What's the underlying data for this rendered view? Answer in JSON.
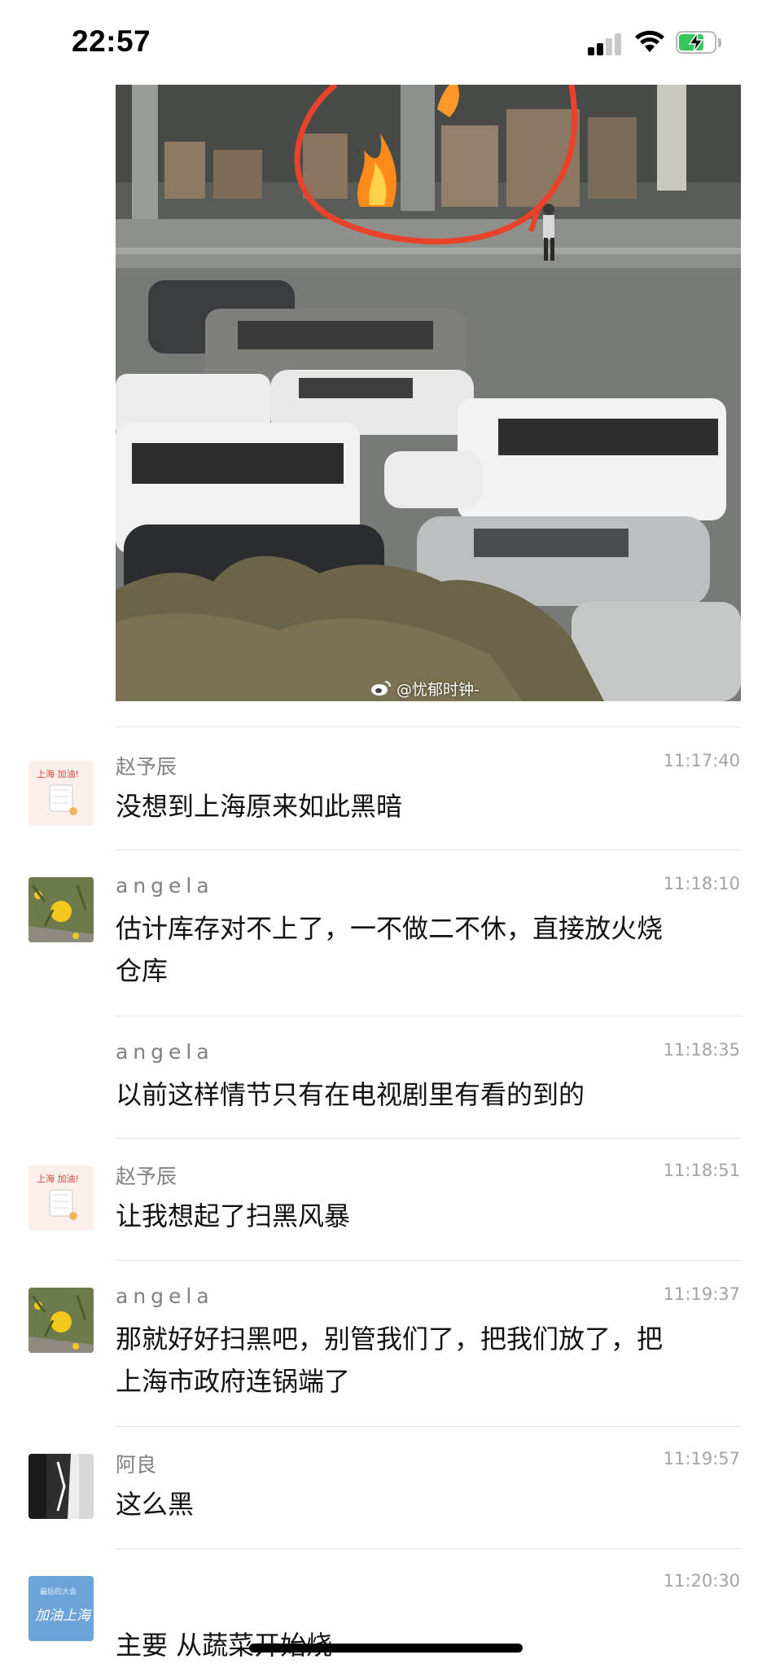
{
  "status_bar": {
    "time": "22:57"
  },
  "shared_image": {
    "description_icon": "weibo-icon",
    "watermark": "@忧郁时钟-"
  },
  "messages": [
    {
      "sender": "赵予辰",
      "time": "11:17:40",
      "text": "没想到上海原来如此黑暗",
      "avatar": "avatar-zhao",
      "avatar_text": "上海 加油!"
    },
    {
      "sender": "angela",
      "time": "11:18:10",
      "text_lines": [
        "估计库存对不上了，一不做二不休，直接放火烧",
        "仓库"
      ],
      "avatar": "avatar-angela"
    },
    {
      "sender": "angela",
      "time": "11:18:35",
      "text": "以前这样情节只有在电视剧里有看的到的"
    },
    {
      "sender": "赵予辰",
      "time": "11:18:51",
      "text": "让我想起了扫黑风暴",
      "avatar": "avatar-zhao",
      "avatar_text": "上海 加油!"
    },
    {
      "sender": "angela",
      "time": "11:19:37",
      "text_lines": [
        "那就好好扫黑吧，别管我们了，把我们放了，把",
        "上海市政府连锅端了"
      ],
      "avatar": "avatar-angela"
    },
    {
      "sender": "阿良",
      "time": "11:19:57",
      "text": "这么黑",
      "avatar": "avatar-aliang"
    },
    {
      "sender": "",
      "time": "11:20:30",
      "text": "主要 从蔬菜开始烧",
      "avatar": "avatar-shanghai",
      "avatar_text_top": "最后的大会",
      "avatar_text_main": "加油上海"
    }
  ],
  "colors": {
    "battery": "#35c759",
    "annotation": "#e8432a"
  }
}
